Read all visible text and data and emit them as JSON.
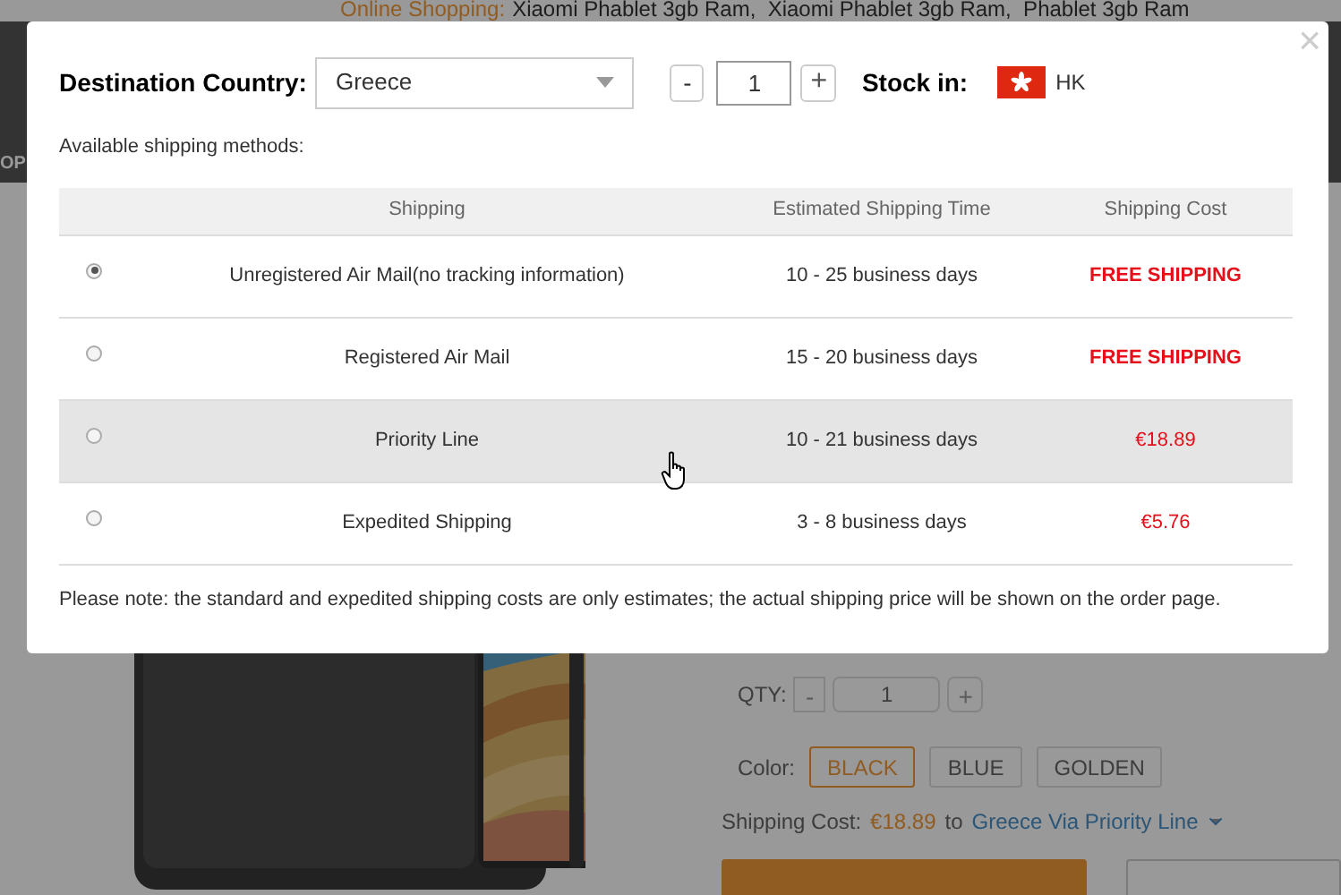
{
  "background_page": {
    "header_link": "Online Shopping:",
    "header_text": "Xiaomi Phablet 3gb Ram,  Xiaomi Phablet 3gb Ram,  Phablet 3gb Ram",
    "nav_fragment": "OP",
    "qty_label": "QTY:",
    "qty_minus": "-",
    "qty_value": "1",
    "qty_plus": "+",
    "color_label": "Color:",
    "colors": [
      {
        "label": "BLACK",
        "selected": true
      },
      {
        "label": "BLUE",
        "selected": false
      },
      {
        "label": "GOLDEN",
        "selected": false
      }
    ],
    "shipping_label": "Shipping Cost:",
    "shipping_price": "€18.89",
    "shipping_to": "to",
    "shipping_destination": "Greece Via Priority Line"
  },
  "dialog": {
    "close": "×",
    "destination_label": "Destination Country:",
    "country": "Greece",
    "qty_minus": "-",
    "qty_value": "1",
    "qty_plus": "+",
    "stock_label": "Stock in:",
    "stock_location": "HK",
    "methods_label": "Available shipping methods:",
    "table": {
      "columns": [
        "Shipping",
        "Estimated Shipping Time",
        "Shipping Cost"
      ],
      "rows": [
        {
          "selected": true,
          "highlighted": false,
          "shipping": "Unregistered Air Mail(no tracking information)",
          "time": "10 - 25 business days",
          "cost": "FREE SHIPPING",
          "kind": "free"
        },
        {
          "selected": false,
          "highlighted": false,
          "shipping": "Registered Air Mail",
          "time": "15 - 20 business days",
          "cost": "FREE SHIPPING",
          "kind": "free"
        },
        {
          "selected": false,
          "highlighted": true,
          "shipping": "Priority Line",
          "time": "10 - 21 business days",
          "cost": "€18.89",
          "kind": "paid"
        },
        {
          "selected": false,
          "highlighted": false,
          "shipping": "Expedited Shipping",
          "time": "3 - 8 business days",
          "cost": "€5.76",
          "kind": "paid"
        }
      ]
    },
    "note": "Please note: the standard and expedited shipping costs are only estimates; the actual shipping price will be shown on the order page."
  }
}
